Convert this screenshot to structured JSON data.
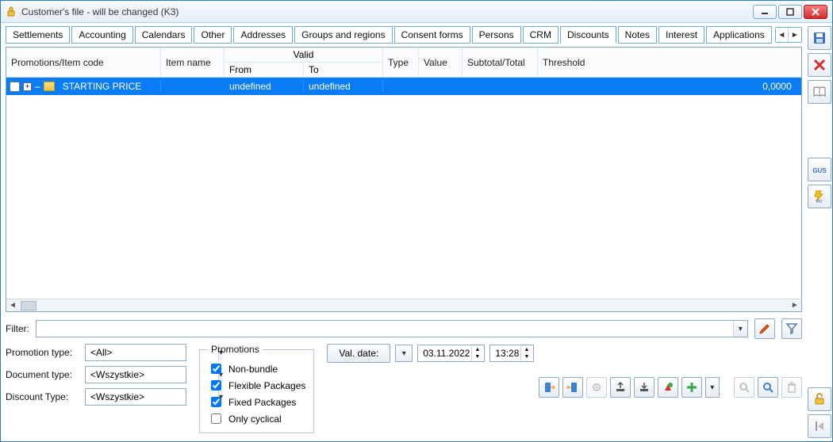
{
  "window": {
    "title": "Customer's file - will be changed (K3)"
  },
  "tabs": [
    "Settlements",
    "Accounting",
    "Calendars",
    "Other",
    "Addresses",
    "Groups and regions",
    "Consent forms",
    "Persons",
    "CRM",
    "Discounts",
    "Notes",
    "Interest",
    "Applications"
  ],
  "active_tab_index": 9,
  "grid": {
    "headers": {
      "promotions": "Promotions/Item code",
      "item_name": "Item name",
      "valid": "Valid",
      "from": "From",
      "to": "To",
      "type": "Type",
      "value": "Value",
      "subtotal": "Subtotal/Total",
      "threshold": "Threshold"
    },
    "rows": [
      {
        "label": "STARTING PRICE",
        "item_name": "",
        "from": "undefined",
        "to": "undefined",
        "type": "",
        "value": "",
        "subtotal": "",
        "threshold": "0,0000"
      }
    ]
  },
  "filter": {
    "label": "Filter:",
    "value": ""
  },
  "form": {
    "promotion_type": {
      "label": "Promotion type:",
      "value": "<All>"
    },
    "document_type": {
      "label": "Document type:",
      "value": "<Wszystkie>"
    },
    "discount_type": {
      "label": "Discount Type:",
      "value": "<Wszystkie>"
    }
  },
  "promotions_box": {
    "legend": "Promotions",
    "non_bundle": {
      "label": "Non-bundle",
      "checked": true
    },
    "flexible": {
      "label": "Flexible Packages",
      "checked": true
    },
    "fixed": {
      "label": "Fixed Packages",
      "checked": true
    },
    "only_cyclical": {
      "label": "Only cyclical",
      "checked": false
    }
  },
  "valdate": {
    "button": "Val. date:",
    "date": "03.11.2022",
    "time": "13:28"
  }
}
